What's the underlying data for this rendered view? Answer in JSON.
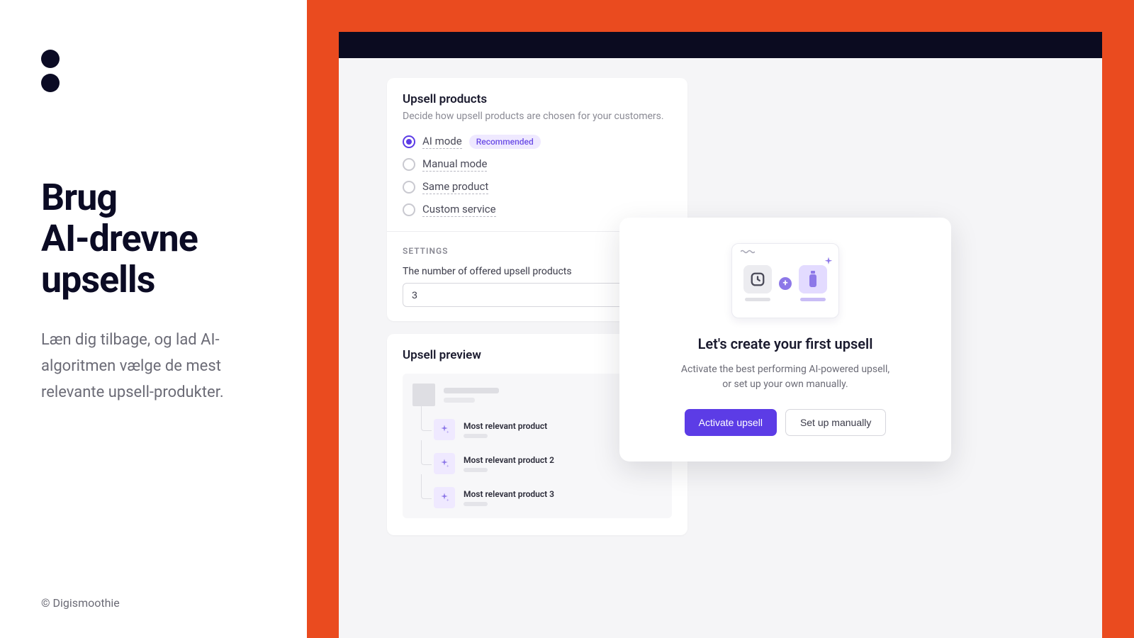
{
  "left": {
    "heading_line1": "Brug",
    "heading_line2": "AI-drevne",
    "heading_line3": "upsells",
    "subtext": "Læn dig tilbage, og lad AI-algoritmen vælge de mest relevante upsell-produkter.",
    "copyright": "© Digismoothie"
  },
  "upsell": {
    "title": "Upsell products",
    "description": "Decide how upsell products are chosen for your customers.",
    "options": [
      {
        "label": "AI mode",
        "selected": true,
        "badge": "Recommended"
      },
      {
        "label": "Manual mode",
        "selected": false
      },
      {
        "label": "Same product",
        "selected": false
      },
      {
        "label": "Custom service",
        "selected": false
      }
    ],
    "settings_label": "SETTINGS",
    "count_label": "The number of offered upsell products",
    "count_value": "3"
  },
  "preview": {
    "title": "Upsell preview",
    "items": [
      {
        "label": "Most relevant product"
      },
      {
        "label": "Most relevant product 2"
      },
      {
        "label": "Most relevant product 3"
      }
    ]
  },
  "modal": {
    "title": "Let's create your first upsell",
    "text_line1": "Activate the best performing AI-powered upsell,",
    "text_line2": "or set up your own manually.",
    "primary": "Activate upsell",
    "secondary": "Set up manually"
  }
}
